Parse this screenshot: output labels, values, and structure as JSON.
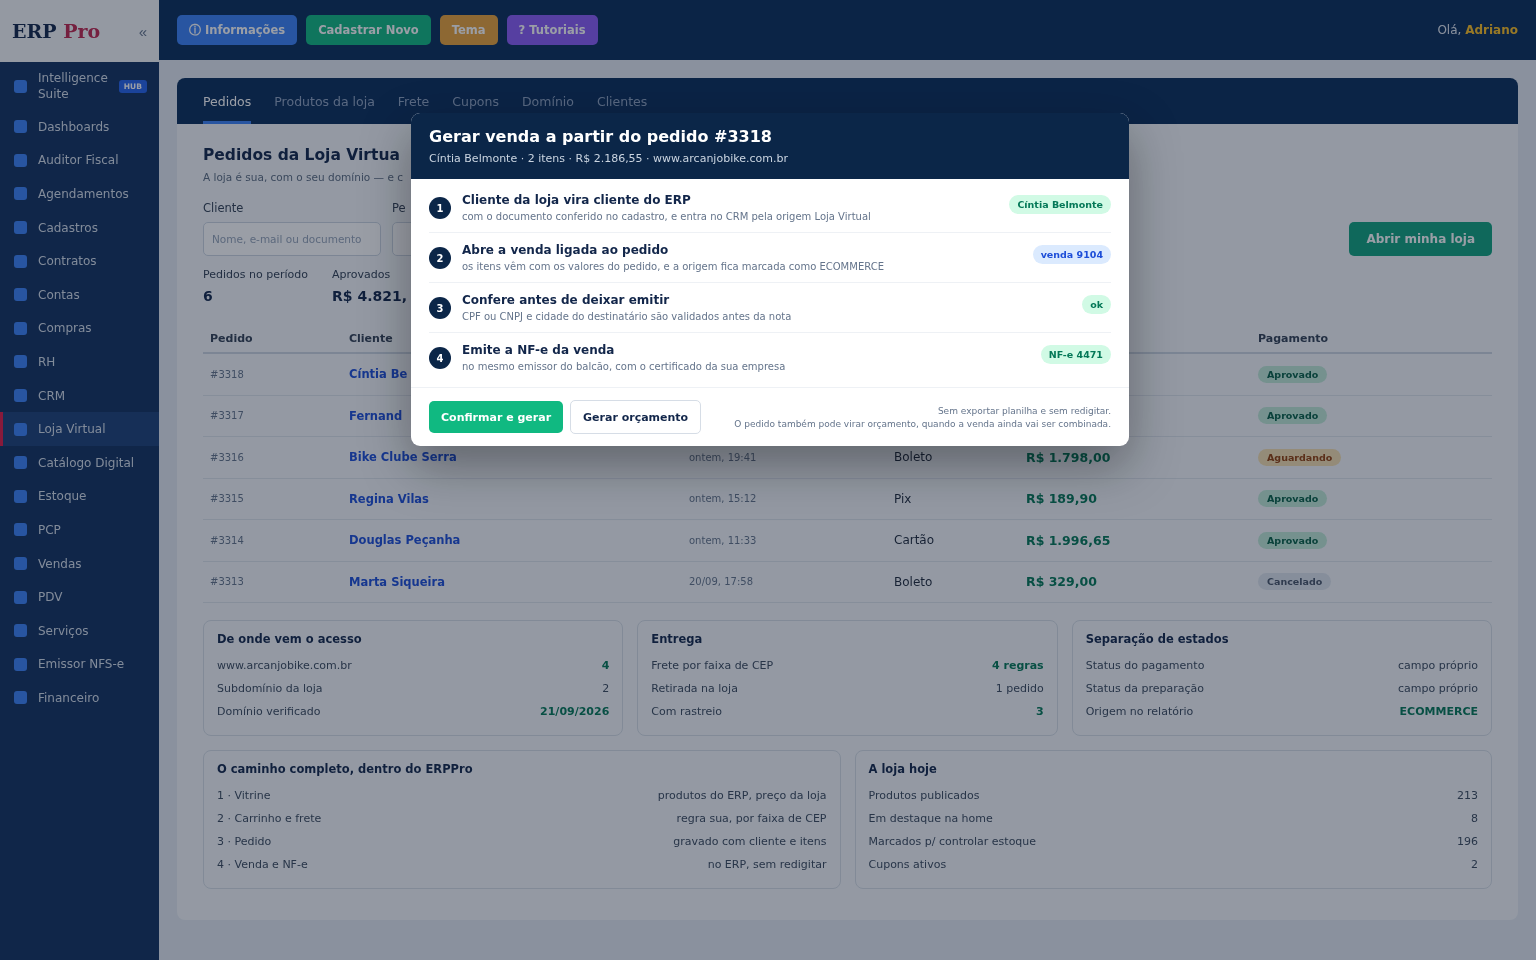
{
  "sidebar": {
    "logo": {
      "main": "ERP",
      "accent": "Pro"
    },
    "collapse": "«",
    "items": [
      {
        "label": "Intelligence Suite",
        "badge": "HUB",
        "selected": false
      },
      {
        "label": "Dashboards",
        "selected": false
      },
      {
        "label": "Auditor Fiscal",
        "selected": false
      },
      {
        "label": "Agendamentos",
        "selected": false
      },
      {
        "label": "Cadastros",
        "selected": false
      },
      {
        "label": "Contratos",
        "selected": false
      },
      {
        "label": "Contas",
        "selected": false
      },
      {
        "label": "Compras",
        "selected": false
      },
      {
        "label": "RH",
        "selected": false
      },
      {
        "label": "CRM",
        "selected": false
      },
      {
        "label": "Loja Virtual",
        "selected": true
      },
      {
        "label": "Catálogo Digital",
        "selected": false
      },
      {
        "label": "Estoque",
        "selected": false
      },
      {
        "label": "PCP",
        "selected": false
      },
      {
        "label": "Vendas",
        "selected": false
      },
      {
        "label": "PDV",
        "selected": false
      },
      {
        "label": "Serviços",
        "selected": false
      },
      {
        "label": "Emissor NFS-e",
        "selected": false
      },
      {
        "label": "Financeiro",
        "selected": false
      }
    ]
  },
  "topbar": {
    "buttons": [
      {
        "label": "ⓘ Informações",
        "kind": "info"
      },
      {
        "label": "Cadastrar Novo",
        "kind": "create"
      },
      {
        "label": "Tema",
        "kind": "theme"
      },
      {
        "label": "? Tutoriais",
        "kind": "help"
      }
    ],
    "greeting": "Olá,",
    "user": "Adriano"
  },
  "tabs": [
    {
      "label": "Pedidos",
      "selected": true
    },
    {
      "label": "Produtos da loja",
      "selected": false
    },
    {
      "label": "Frete",
      "selected": false
    },
    {
      "label": "Cupons",
      "selected": false
    },
    {
      "label": "Domínio",
      "selected": false
    },
    {
      "label": "Clientes",
      "selected": false
    }
  ],
  "page": {
    "title": "Pedidos da Loja Virtua",
    "subtitle": "A loja é sua, com o seu domínio — e c",
    "open_store_button": "Abrir minha loja"
  },
  "filters": [
    {
      "label": "Cliente",
      "placeholder": "Nome, e-mail ou documento"
    },
    {
      "label": "Pe"
    }
  ],
  "stats": [
    {
      "label": "Pedidos no período",
      "value": "6"
    },
    {
      "label": "Aprovados",
      "value": "R$ 4.821,"
    }
  ],
  "table": {
    "columns": [
      "Pedido",
      "Cliente",
      "Pagamento"
    ],
    "rows": [
      {
        "order": "#3318",
        "client": "Cíntia Be",
        "status": "Aprovado",
        "kind": "approved"
      },
      {
        "order": "#3317",
        "client": "Fernand",
        "status": "Aprovado",
        "kind": "approved"
      },
      {
        "order": "#3316",
        "client": "Bike Clube Serra",
        "date": "ontem, 19:41",
        "method": "Boleto",
        "value": "R$ 1.798,00",
        "status": "Aguardando",
        "kind": "pending"
      },
      {
        "order": "#3315",
        "client": "Regina Vilas",
        "date": "ontem, 15:12",
        "method": "Pix",
        "value": "R$ 189,90",
        "status": "Aprovado",
        "kind": "approved"
      },
      {
        "order": "#3314",
        "client": "Douglas Peçanha",
        "date": "ontem, 11:33",
        "method": "Cartão",
        "value": "R$ 1.996,65",
        "status": "Aprovado",
        "kind": "approved"
      },
      {
        "order": "#3313",
        "client": "Marta Siqueira",
        "date": "20/09, 17:58",
        "method": "Boleto",
        "value": "R$ 329,00",
        "status": "Cancelado",
        "kind": "cancelled"
      }
    ]
  },
  "cards": [
    {
      "title": "De onde vem o acesso",
      "rows": [
        {
          "label": "www.arcanjobike.com.br",
          "value": "4",
          "highlight": true
        },
        {
          "label": "Subdomínio da loja",
          "value": "2",
          "highlight": false
        },
        {
          "label": "Domínio verificado",
          "value": "21/09/2026",
          "highlight": true
        }
      ]
    },
    {
      "title": "Entrega",
      "rows": [
        {
          "label": "Frete por faixa de CEP",
          "value": "4 regras",
          "highlight": true
        },
        {
          "label": "Retirada na loja",
          "value": "1 pedido",
          "highlight": false
        },
        {
          "label": "Com rastreio",
          "value": "3",
          "highlight": true
        }
      ]
    },
    {
      "title": "Separação de estados",
      "rows": [
        {
          "label": "Status do pagamento",
          "value": "campo próprio",
          "highlight": false
        },
        {
          "label": "Status da preparação",
          "value": "campo próprio",
          "highlight": false
        },
        {
          "label": "Origem no relatório",
          "value": "ECOMMERCE",
          "highlight": true
        }
      ]
    },
    {
      "title": "O caminho completo, dentro do ERPPro",
      "rows": [
        {
          "label": "1 · Vitrine",
          "value": "produtos do ERP, preço da loja",
          "highlight": false
        },
        {
          "label": "2 · Carrinho e frete",
          "value": "regra sua, por faixa de CEP",
          "highlight": false
        },
        {
          "label": "3 · Pedido",
          "value": "gravado com cliente e itens",
          "highlight": false
        },
        {
          "label": "4 · Venda e NF-e",
          "value": "no ERP, sem redigitar",
          "highlight": false
        }
      ]
    },
    {
      "title": "A loja hoje",
      "rows": [
        {
          "label": "Produtos publicados",
          "value": "213",
          "highlight": false
        },
        {
          "label": "Em destaque na home",
          "value": "8",
          "highlight": false
        },
        {
          "label": "Marcados p/ controlar estoque",
          "value": "196",
          "highlight": false
        },
        {
          "label": "Cupons ativos",
          "value": "2",
          "highlight": false
        }
      ]
    }
  ],
  "modal": {
    "title": "Gerar venda a partir do pedido #3318",
    "subtitle": "Cíntia Belmonte · 2 itens · R$ 2.186,55 · www.arcanjobike.com.br",
    "steps": [
      {
        "number": "1",
        "title": "Cliente da loja vira cliente do ERP",
        "description": "com o documento conferido no cadastro, e entra no CRM pela origem Loja Virtual",
        "badge": "Cíntia Belmonte",
        "kind": "success"
      },
      {
        "number": "2",
        "title": "Abre a venda ligada ao pedido",
        "description": "os itens vêm com os valores do pedido, e a origem fica marcada como ECOMMERCE",
        "badge": "venda 9104",
        "kind": "info"
      },
      {
        "number": "3",
        "title": "Confere antes de deixar emitir",
        "description": "CPF ou CNPJ e cidade do destinatário são validados antes da nota",
        "badge": "ok",
        "kind": "success"
      },
      {
        "number": "4",
        "title": "Emite a NF-e da venda",
        "description": "no mesmo emissor do balcão, com o certificado da sua empresa",
        "badge": "NF-e 4471",
        "kind": "success"
      }
    ],
    "primary_button": "Confirmar e gerar",
    "secondary_button": "Gerar orçamento",
    "notes": [
      "Sem exportar planilha e sem redigitar.",
      "O pedido também pode virar orçamento, quando a venda ainda vai ser combinada."
    ]
  }
}
